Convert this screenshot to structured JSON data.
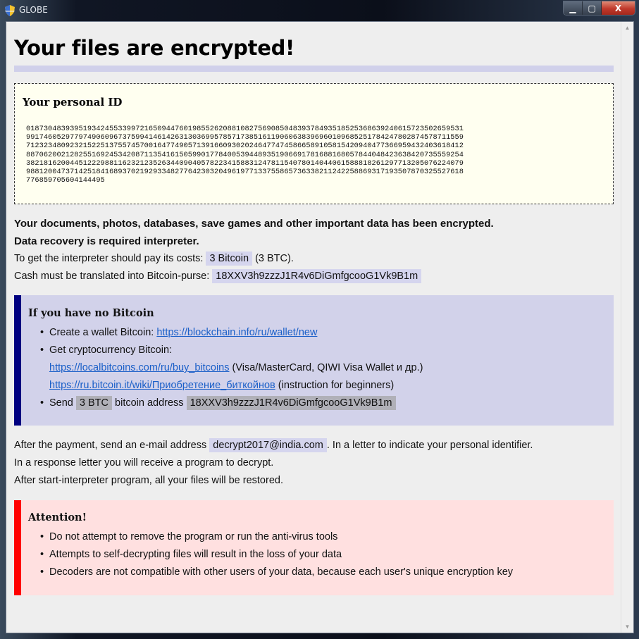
{
  "window": {
    "title": "GLOBE",
    "app_icon": "shield-icon",
    "buttons": {
      "minimize": "▁",
      "maximize": "▢",
      "close": "X"
    }
  },
  "scrollbar": {
    "up": "▲",
    "down": "▼"
  },
  "header": {
    "title": "Your files are encrypted!"
  },
  "personal_id": {
    "label": "Your personal ID",
    "lines": [
      "0187304839395193424553399721650944760198552620881082756908504839378493518525368639240615723502659531",
      "9917460529779749060967375994146142631303699578571738516119060638396960109685251784247802874578711559",
      "7123234809232152251375574570016477490571391660930202464774745866589105815420940477366959432403618412",
      "8870620021282551692453420871135416150599017784005394489351906691781688168057844048423638420735559254",
      "3821816200445122298811623212352634409040578223415883124781154078014044061588818261297713205076224079",
      "9881200473714251841689370219293348277642303204961977133755865736338211242258869317193507870325527618",
      "776859705604144495"
    ]
  },
  "intro": {
    "line1": "Your documents, photos, databases, save games and other important data has been encrypted.",
    "line2": "Data recovery is required interpreter.",
    "cost_prefix": "To get the interpreter should pay its costs:",
    "cost_value": "3 Bitcoin",
    "cost_suffix": "(3 BTC).",
    "purse_prefix": "Cash must be translated into Bitcoin-purse:",
    "purse_value": "18XXV3h9zzzJ1R4v6DiGmfgcooG1Vk9B1m"
  },
  "no_bitcoin": {
    "title": "If you have no Bitcoin",
    "item1_text": "Create a wallet Bitcoin:",
    "item1_link": "https://blockchain.info/ru/wallet/new",
    "item2_text": "Get cryptocurrency Bitcoin:",
    "link2": "https://localbitcoins.com/ru/buy_bitcoins",
    "link2_note": "(Visa/MasterCard, QIWI Visa Wallet и др.)",
    "link3": "https://ru.bitcoin.it/wiki/Приобретение_биткойнов",
    "link3_note": "(instruction for beginners)",
    "send_label": "Send",
    "send_amount": "3 BTC",
    "send_middle": "bitcoin address",
    "send_address": "18XXV3h9zzzJ1R4v6DiGmfgcooG1Vk9B1m"
  },
  "after": {
    "email_prefix": "After the payment, send an e-mail address",
    "email": "decrypt2017@india.com",
    "email_suffix": ". In a letter to indicate your personal identifier.",
    "line2": "In a response letter you will receive a program to decrypt.",
    "line3": "After start-interpreter program, all your files will be restored."
  },
  "attention": {
    "title": "Attention!",
    "items": [
      "Do not attempt to remove the program or run the anti-virus tools",
      "Attempts to self-decrypting files will result in the loss of your data",
      "Decoders are not compatible with other users of your data, because each user's unique encryption key"
    ]
  },
  "colors": {
    "blue_accent": "#000080",
    "red_accent": "#ff0000",
    "link": "#1a5fc8",
    "highlight": "#d5d5ee"
  }
}
